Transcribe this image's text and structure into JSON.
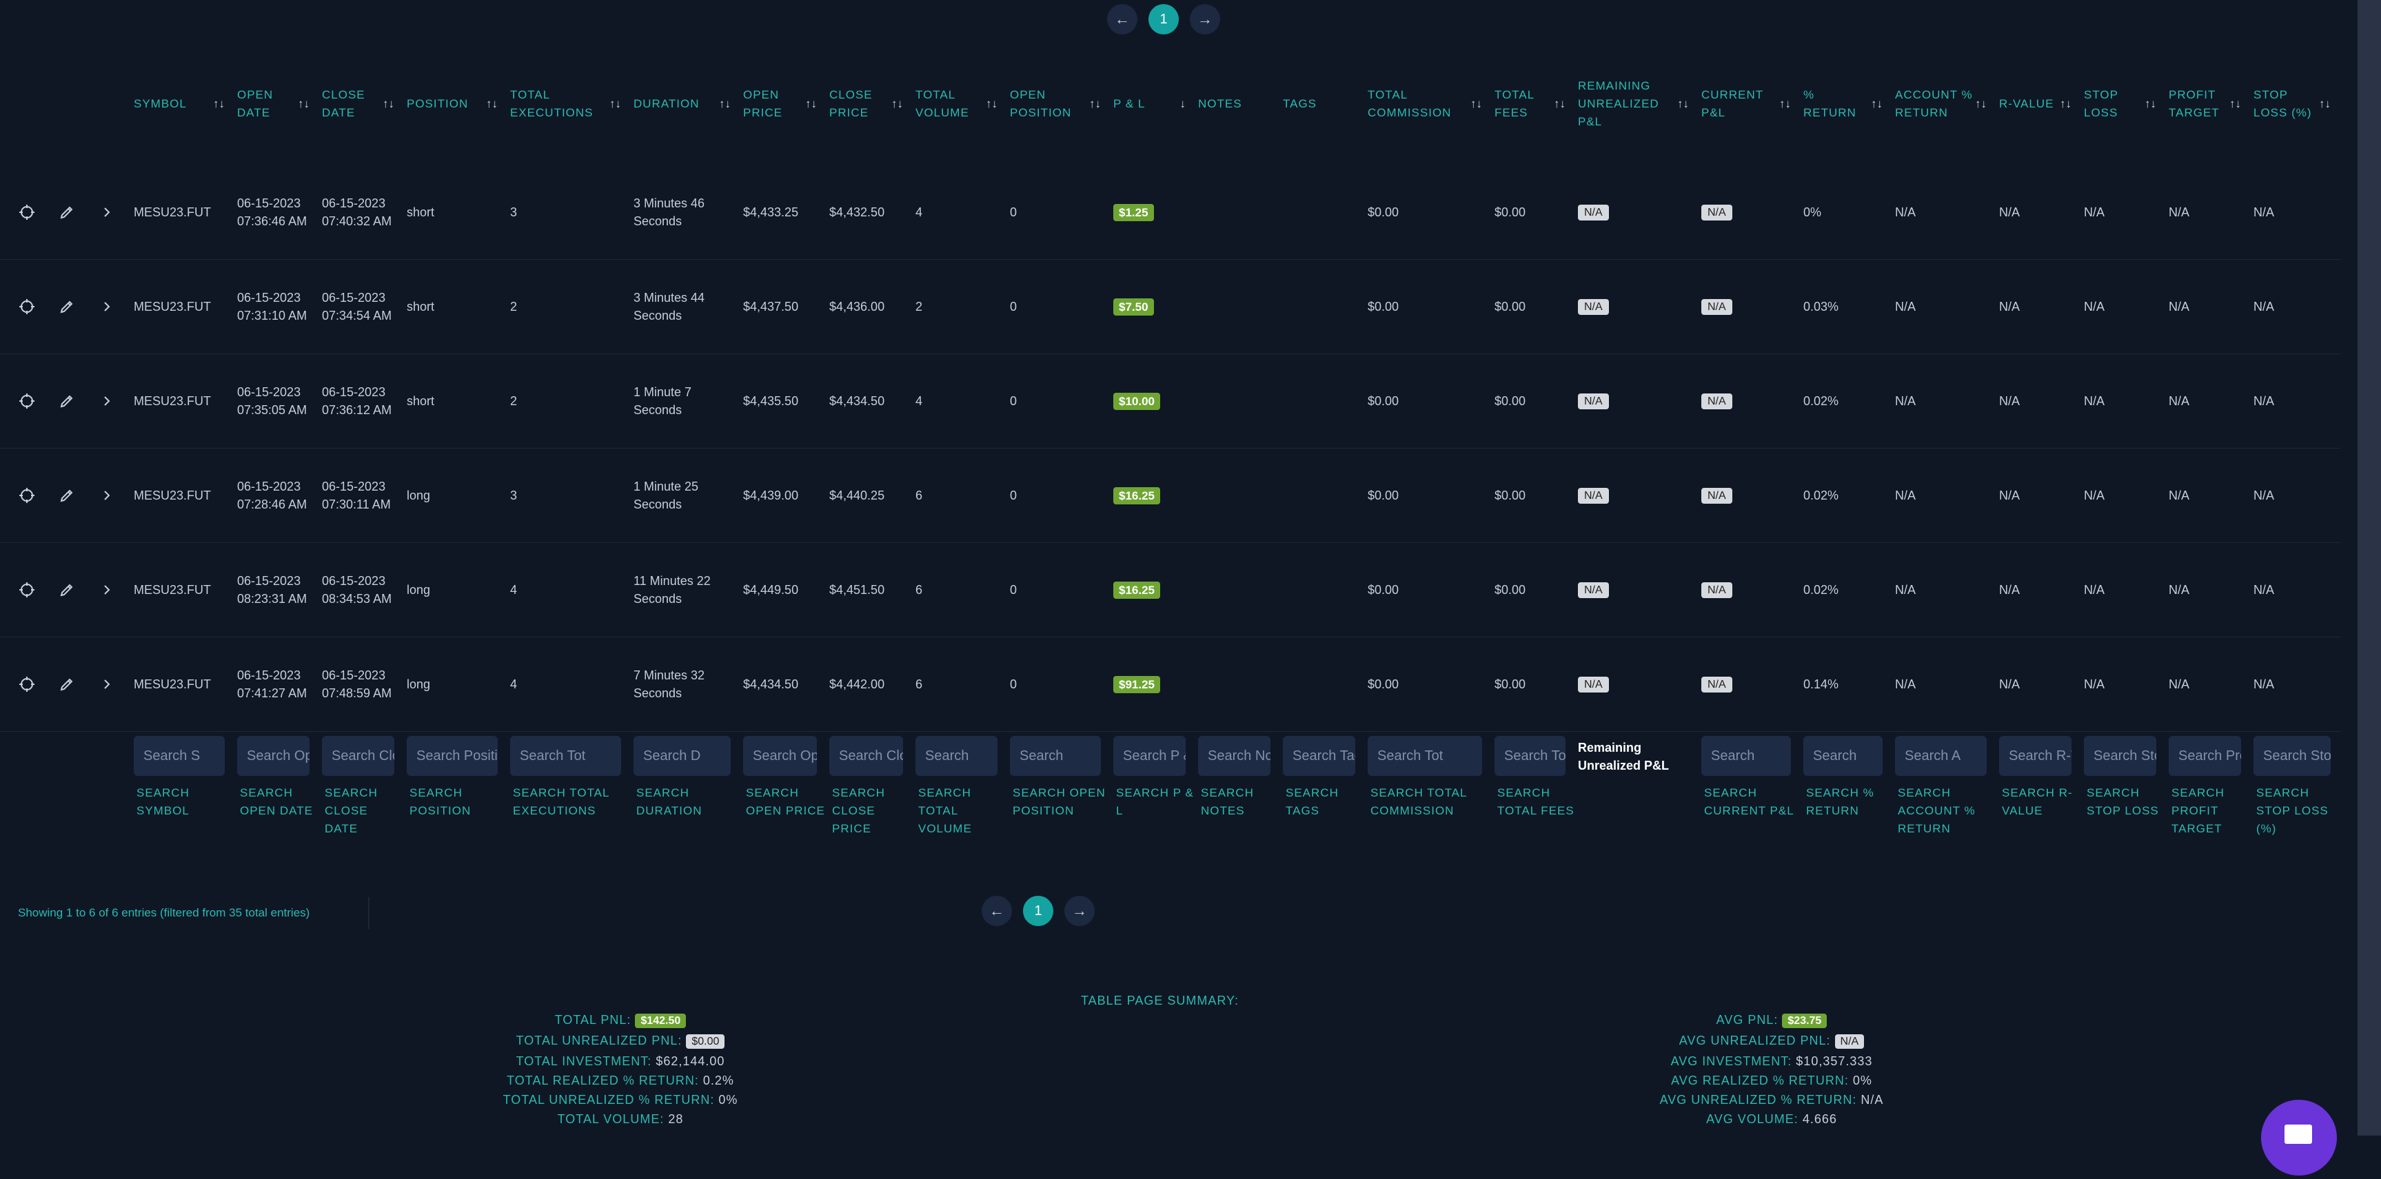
{
  "pagination": {
    "prev": "←",
    "page": "1",
    "next": "→"
  },
  "columns": [
    {
      "label": "SYMBOL",
      "sort": "↑↓"
    },
    {
      "label": "OPEN DATE",
      "sort": "↑↓"
    },
    {
      "label": "CLOSE DATE",
      "sort": "↑↓"
    },
    {
      "label": "POSITION",
      "sort": "↑↓"
    },
    {
      "label": "TOTAL EXECUTIONS",
      "sort": "↑↓"
    },
    {
      "label": "DURATION",
      "sort": "↑↓"
    },
    {
      "label": "OPEN PRICE",
      "sort": "↑↓"
    },
    {
      "label": "CLOSE PRICE",
      "sort": "↑↓"
    },
    {
      "label": "TOTAL VOLUME",
      "sort": "↑↓"
    },
    {
      "label": "OPEN POSITION",
      "sort": "↑↓"
    },
    {
      "label": "P & L",
      "sort": "↓"
    },
    {
      "label": "NOTES",
      "sort": ""
    },
    {
      "label": "TAGS",
      "sort": ""
    },
    {
      "label": "TOTAL COMMISSION",
      "sort": "↑↓"
    },
    {
      "label": "TOTAL FEES",
      "sort": "↑↓"
    },
    {
      "label": "REMAINING UNREALIZED P&L",
      "sort": "↑↓"
    },
    {
      "label": "CURRENT P&L",
      "sort": "↑↓"
    },
    {
      "label": "% RETURN",
      "sort": "↑↓"
    },
    {
      "label": "ACCOUNT % RETURN",
      "sort": "↑↓"
    },
    {
      "label": "R-VALUE",
      "sort": "↑↓"
    },
    {
      "label": "STOP LOSS",
      "sort": "↑↓"
    },
    {
      "label": "PROFIT TARGET",
      "sort": "↑↓"
    },
    {
      "label": "STOP LOSS (%)",
      "sort": "↑↓"
    }
  ],
  "rows": [
    {
      "symbol": "MESU23.FUT",
      "open_date": "06-15-2023 07:36:46 AM",
      "close_date": "06-15-2023 07:40:32 AM",
      "position": "short",
      "executions": "3",
      "duration": "3 Minutes 46 Seconds",
      "open_price": "$4,433.25",
      "close_price": "$4,432.50",
      "volume": "4",
      "open_position": "0",
      "pnl": "$1.25",
      "notes": "",
      "tags": "",
      "commission": "$0.00",
      "fees": "$0.00",
      "remaining": "N/A",
      "current": "N/A",
      "return": "0%",
      "account_return": "N/A",
      "r_value": "N/A",
      "stop_loss": "N/A",
      "profit_target": "N/A",
      "stop_loss_pct": "N/A"
    },
    {
      "symbol": "MESU23.FUT",
      "open_date": "06-15-2023 07:31:10 AM",
      "close_date": "06-15-2023 07:34:54 AM",
      "position": "short",
      "executions": "2",
      "duration": "3 Minutes 44 Seconds",
      "open_price": "$4,437.50",
      "close_price": "$4,436.00",
      "volume": "2",
      "open_position": "0",
      "pnl": "$7.50",
      "notes": "",
      "tags": "",
      "commission": "$0.00",
      "fees": "$0.00",
      "remaining": "N/A",
      "current": "N/A",
      "return": "0.03%",
      "account_return": "N/A",
      "r_value": "N/A",
      "stop_loss": "N/A",
      "profit_target": "N/A",
      "stop_loss_pct": "N/A"
    },
    {
      "symbol": "MESU23.FUT",
      "open_date": "06-15-2023 07:35:05 AM",
      "close_date": "06-15-2023 07:36:12 AM",
      "position": "short",
      "executions": "2",
      "duration": "1 Minute 7 Seconds",
      "open_price": "$4,435.50",
      "close_price": "$4,434.50",
      "volume": "4",
      "open_position": "0",
      "pnl": "$10.00",
      "notes": "",
      "tags": "",
      "commission": "$0.00",
      "fees": "$0.00",
      "remaining": "N/A",
      "current": "N/A",
      "return": "0.02%",
      "account_return": "N/A",
      "r_value": "N/A",
      "stop_loss": "N/A",
      "profit_target": "N/A",
      "stop_loss_pct": "N/A"
    },
    {
      "symbol": "MESU23.FUT",
      "open_date": "06-15-2023 07:28:46 AM",
      "close_date": "06-15-2023 07:30:11 AM",
      "position": "long",
      "executions": "3",
      "duration": "1 Minute 25 Seconds",
      "open_price": "$4,439.00",
      "close_price": "$4,440.25",
      "volume": "6",
      "open_position": "0",
      "pnl": "$16.25",
      "notes": "",
      "tags": "",
      "commission": "$0.00",
      "fees": "$0.00",
      "remaining": "N/A",
      "current": "N/A",
      "return": "0.02%",
      "account_return": "N/A",
      "r_value": "N/A",
      "stop_loss": "N/A",
      "profit_target": "N/A",
      "stop_loss_pct": "N/A"
    },
    {
      "symbol": "MESU23.FUT",
      "open_date": "06-15-2023 08:23:31 AM",
      "close_date": "06-15-2023 08:34:53 AM",
      "position": "long",
      "executions": "4",
      "duration": "11 Minutes 22 Seconds",
      "open_price": "$4,449.50",
      "close_price": "$4,451.50",
      "volume": "6",
      "open_position": "0",
      "pnl": "$16.25",
      "notes": "",
      "tags": "",
      "commission": "$0.00",
      "fees": "$0.00",
      "remaining": "N/A",
      "current": "N/A",
      "return": "0.02%",
      "account_return": "N/A",
      "r_value": "N/A",
      "stop_loss": "N/A",
      "profit_target": "N/A",
      "stop_loss_pct": "N/A"
    },
    {
      "symbol": "MESU23.FUT",
      "open_date": "06-15-2023 07:41:27 AM",
      "close_date": "06-15-2023 07:48:59 AM",
      "position": "long",
      "executions": "4",
      "duration": "7 Minutes 32 Seconds",
      "open_price": "$4,434.50",
      "close_price": "$4,442.00",
      "volume": "6",
      "open_position": "0",
      "pnl": "$91.25",
      "notes": "",
      "tags": "",
      "commission": "$0.00",
      "fees": "$0.00",
      "remaining": "N/A",
      "current": "N/A",
      "return": "0.14%",
      "account_return": "N/A",
      "r_value": "N/A",
      "stop_loss": "N/A",
      "profit_target": "N/A",
      "stop_loss_pct": "N/A"
    }
  ],
  "search": [
    {
      "placeholder": "Search S",
      "label": "SEARCH SYMBOL"
    },
    {
      "placeholder": "Search Open Date",
      "label": "SEARCH OPEN DATE"
    },
    {
      "placeholder": "Search Close Date",
      "label": "SEARCH CLOSE DATE"
    },
    {
      "placeholder": "Search Position",
      "label": "SEARCH POSITION"
    },
    {
      "placeholder": "Search Tot",
      "label": "SEARCH TOTAL EXECUTIONS"
    },
    {
      "placeholder": "Search D",
      "label": "SEARCH DURATION"
    },
    {
      "placeholder": "Search Open Price",
      "label": "SEARCH OPEN PRICE"
    },
    {
      "placeholder": "Search Close Price",
      "label": "SEARCH CLOSE PRICE"
    },
    {
      "placeholder": "Search",
      "label": "SEARCH TOTAL VOLUME"
    },
    {
      "placeholder": "Search",
      "label": "SEARCH OPEN POSITION"
    },
    {
      "placeholder": "Search P & L",
      "label": "SEARCH P & L"
    },
    {
      "placeholder": "Search Notes",
      "label": "SEARCH NOTES"
    },
    {
      "placeholder": "Search Tags",
      "label": "SEARCH TAGS"
    },
    {
      "placeholder": "Search Tot",
      "label": "SEARCH TOTAL COMMISSION"
    },
    {
      "placeholder": "Search Total Fees",
      "label": "SEARCH TOTAL FEES"
    },
    {
      "static": "Remaining Unrealized P&L"
    },
    {
      "placeholder": "Search",
      "label": "SEARCH CURRENT P&L"
    },
    {
      "placeholder": "Search",
      "label": "SEARCH % RETURN"
    },
    {
      "placeholder": "Search A",
      "label": "SEARCH ACCOUNT % RETURN"
    },
    {
      "placeholder": "Search R-Value",
      "label": "SEARCH R-VALUE"
    },
    {
      "placeholder": "Search Stop Loss",
      "label": "SEARCH STOP LOSS"
    },
    {
      "placeholder": "Search Profit Target",
      "label": "SEARCH PROFIT TARGET"
    },
    {
      "placeholder": "Search Stop Loss",
      "label": "SEARCH STOP LOSS (%)"
    }
  ],
  "info_text": "Showing 1 to 6 of 6 entries (filtered from 35 total entries)",
  "summary": {
    "title": "TABLE PAGE SUMMARY:",
    "left": [
      {
        "label": "TOTAL PNL:",
        "value": "$142.50",
        "style": "badge"
      },
      {
        "label": "TOTAL UNREALIZED PNL:",
        "value": "$0.00",
        "style": "na"
      },
      {
        "label": "TOTAL INVESTMENT:",
        "value": "$62,144.00",
        "style": "text"
      },
      {
        "label": "TOTAL REALIZED % RETURN:",
        "value": "0.2%",
        "style": "text"
      },
      {
        "label": "TOTAL UNREALIZED % RETURN:",
        "value": "0%",
        "style": "text"
      },
      {
        "label": "TOTAL VOLUME:",
        "value": "28",
        "style": "text"
      }
    ],
    "right": [
      {
        "label": "AVG PNL:",
        "value": "$23.75",
        "style": "badge"
      },
      {
        "label": "AVG UNREALIZED PNL:",
        "value": "N/A",
        "style": "na"
      },
      {
        "label": "AVG INVESTMENT:",
        "value": "$10,357.333",
        "style": "text"
      },
      {
        "label": "AVG REALIZED % RETURN:",
        "value": "0%",
        "style": "text"
      },
      {
        "label": "AVG UNREALIZED % RETURN:",
        "value": "N/A",
        "style": "text"
      },
      {
        "label": "AVG VOLUME:",
        "value": "4.666",
        "style": "text"
      }
    ]
  },
  "icons": {
    "row_icons": [
      "target-icon",
      "edit-icon",
      "chevron-right-icon"
    ],
    "chat": "chat-icon"
  }
}
